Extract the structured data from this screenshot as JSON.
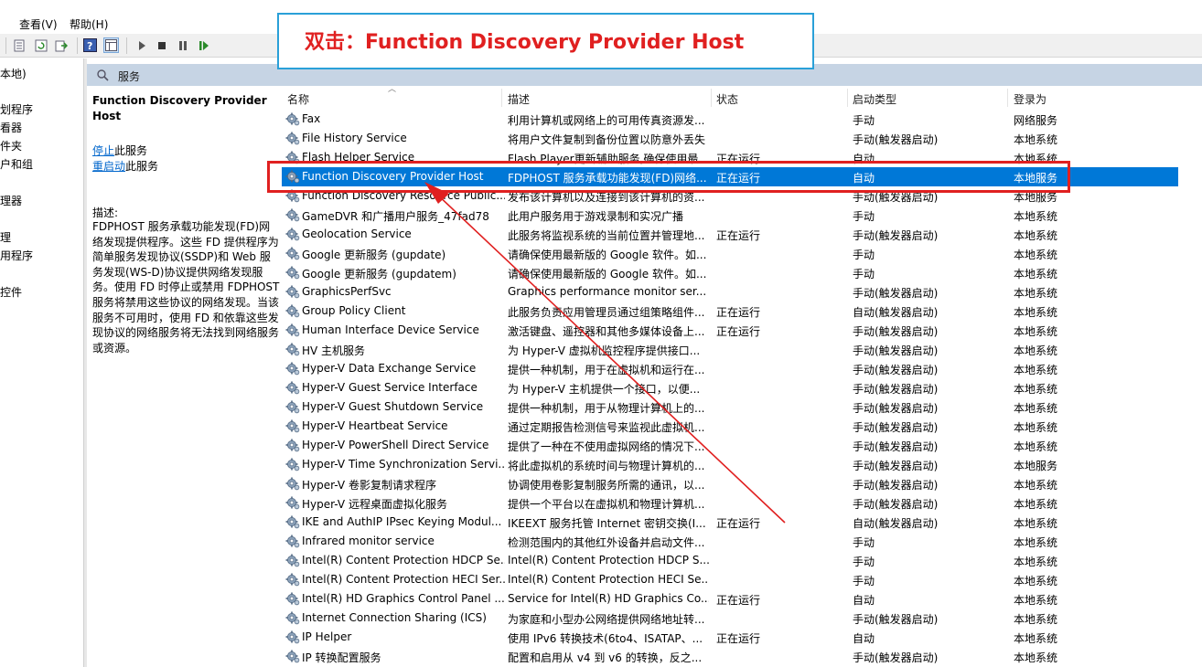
{
  "menu": {
    "view": "查看(V)",
    "help": "帮助(H)"
  },
  "tree": [
    {
      "label": "本地)"
    },
    {
      "label": "划程序"
    },
    {
      "label": "看器"
    },
    {
      "label": "件夹"
    },
    {
      "label": "户和组"
    },
    {
      "label": "理器"
    },
    {
      "label": "理"
    },
    {
      "label": "用程序"
    },
    {
      "label": "控件"
    }
  ],
  "panel": {
    "title": "服务"
  },
  "details": {
    "service_name": "Function Discovery Provider Host",
    "stop_link": "停止",
    "stop_suffix": "此服务",
    "restart_link": "重启动",
    "restart_suffix": "此服务",
    "desc_label": "描述:",
    "desc_text": "FDPHOST 服务承载功能发现(FD)网络发现提供程序。这些 FD 提供程序为简单服务发现协议(SSDP)和 Web 服务发现(WS-D)协议提供网络发现服务。使用 FD 时停止或禁用 FDPHOST 服务将禁用这些协议的网络发现。当该服务不可用时，使用 FD 和依靠这些发现协议的网络服务将无法找到网络服务或资源。"
  },
  "columns": {
    "name": "名称",
    "desc": "描述",
    "status": "状态",
    "startup": "启动类型",
    "logon": "登录为"
  },
  "rows": [
    {
      "name": "Fax",
      "desc": "利用计算机或网络上的可用传真资源发...",
      "status": "",
      "startup": "手动",
      "logon": "网络服务"
    },
    {
      "name": "File History Service",
      "desc": "将用户文件复制到备份位置以防意外丢失",
      "status": "",
      "startup": "手动(触发器启动)",
      "logon": "本地系统"
    },
    {
      "name": "Flash Helper Service",
      "desc": "Flash Player更新辅助服务,确保使用最...",
      "status": "正在运行",
      "startup": "自动",
      "logon": "本地系统"
    },
    {
      "name": "Function Discovery Provider Host",
      "desc": "FDPHOST 服务承载功能发现(FD)网络...",
      "status": "正在运行",
      "startup": "自动",
      "logon": "本地服务",
      "selected": true
    },
    {
      "name": "Function Discovery Resource Public...",
      "desc": "发布该计算机以及连接到该计算机的资...",
      "status": "",
      "startup": "手动(触发器启动)",
      "logon": "本地服务"
    },
    {
      "name": "GameDVR 和广播用户服务_47fad78",
      "desc": "此用户服务用于游戏录制和实况广播",
      "status": "",
      "startup": "手动",
      "logon": "本地系统"
    },
    {
      "name": "Geolocation Service",
      "desc": "此服务将监视系统的当前位置并管理地...",
      "status": "正在运行",
      "startup": "手动(触发器启动)",
      "logon": "本地系统"
    },
    {
      "name": "Google 更新服务 (gupdate)",
      "desc": "请确保使用最新版的 Google 软件。如...",
      "status": "",
      "startup": "手动",
      "logon": "本地系统"
    },
    {
      "name": "Google 更新服务 (gupdatem)",
      "desc": "请确保使用最新版的 Google 软件。如...",
      "status": "",
      "startup": "手动",
      "logon": "本地系统"
    },
    {
      "name": "GraphicsPerfSvc",
      "desc": "Graphics performance monitor ser...",
      "status": "",
      "startup": "手动(触发器启动)",
      "logon": "本地系统"
    },
    {
      "name": "Group Policy Client",
      "desc": "此服务负责应用管理员通过组策略组件...",
      "status": "正在运行",
      "startup": "自动(触发器启动)",
      "logon": "本地系统"
    },
    {
      "name": "Human Interface Device Service",
      "desc": "激活键盘、遥控器和其他多媒体设备上...",
      "status": "正在运行",
      "startup": "手动(触发器启动)",
      "logon": "本地系统"
    },
    {
      "name": "HV 主机服务",
      "desc": "为 Hyper-V 虚拟机监控程序提供接口...",
      "status": "",
      "startup": "手动(触发器启动)",
      "logon": "本地系统"
    },
    {
      "name": "Hyper-V Data Exchange Service",
      "desc": "提供一种机制，用于在虚拟机和运行在...",
      "status": "",
      "startup": "手动(触发器启动)",
      "logon": "本地系统"
    },
    {
      "name": "Hyper-V Guest Service Interface",
      "desc": "为 Hyper-V 主机提供一个接口，以便...",
      "status": "",
      "startup": "手动(触发器启动)",
      "logon": "本地系统"
    },
    {
      "name": "Hyper-V Guest Shutdown Service",
      "desc": "提供一种机制，用于从物理计算机上的...",
      "status": "",
      "startup": "手动(触发器启动)",
      "logon": "本地系统"
    },
    {
      "name": "Hyper-V Heartbeat Service",
      "desc": "通过定期报告检测信号来监视此虚拟机...",
      "status": "",
      "startup": "手动(触发器启动)",
      "logon": "本地系统"
    },
    {
      "name": "Hyper-V PowerShell Direct Service",
      "desc": "提供了一种在不使用虚拟网络的情况下...",
      "status": "",
      "startup": "手动(触发器启动)",
      "logon": "本地系统"
    },
    {
      "name": "Hyper-V Time Synchronization Servi...",
      "desc": "将此虚拟机的系统时间与物理计算机的...",
      "status": "",
      "startup": "手动(触发器启动)",
      "logon": "本地服务"
    },
    {
      "name": "Hyper-V 卷影复制请求程序",
      "desc": "协调使用卷影复制服务所需的通讯，以...",
      "status": "",
      "startup": "手动(触发器启动)",
      "logon": "本地系统"
    },
    {
      "name": "Hyper-V 远程桌面虚拟化服务",
      "desc": "提供一个平台以在虚拟机和物理计算机...",
      "status": "",
      "startup": "手动(触发器启动)",
      "logon": "本地系统"
    },
    {
      "name": "IKE and AuthIP IPsec Keying Modul...",
      "desc": "IKEEXT 服务托管 Internet 密钥交换(I...",
      "status": "正在运行",
      "startup": "自动(触发器启动)",
      "logon": "本地系统"
    },
    {
      "name": "Infrared monitor service",
      "desc": "检测范围内的其他红外设备并启动文件...",
      "status": "",
      "startup": "手动",
      "logon": "本地系统"
    },
    {
      "name": "Intel(R) Content Protection HDCP Se...",
      "desc": "Intel(R) Content Protection HDCP S...",
      "status": "",
      "startup": "手动",
      "logon": "本地系统"
    },
    {
      "name": "Intel(R) Content Protection HECI Ser...",
      "desc": "Intel(R) Content Protection HECI Se...",
      "status": "",
      "startup": "手动",
      "logon": "本地系统"
    },
    {
      "name": "Intel(R) HD Graphics Control Panel ...",
      "desc": "Service for Intel(R) HD Graphics Co...",
      "status": "正在运行",
      "startup": "自动",
      "logon": "本地系统"
    },
    {
      "name": "Internet Connection Sharing (ICS)",
      "desc": "为家庭和小型办公网络提供网络地址转...",
      "status": "",
      "startup": "手动(触发器启动)",
      "logon": "本地系统"
    },
    {
      "name": "IP Helper",
      "desc": "使用 IPv6 转换技术(6to4、ISATAP、...",
      "status": "正在运行",
      "startup": "自动",
      "logon": "本地系统"
    },
    {
      "name": "IP 转换配置服务",
      "desc": "配置和启用从 v4 到 v6 的转换，反之...",
      "status": "",
      "startup": "手动(触发器启动)",
      "logon": "本地系统"
    }
  ],
  "annotation": {
    "text": "双击：Function Discovery Provider Host"
  },
  "colors": {
    "accent_red": "#e02020",
    "callout_border": "#2aa0d8",
    "selection": "#0078d7",
    "panel_header": "#c6d4e4"
  }
}
